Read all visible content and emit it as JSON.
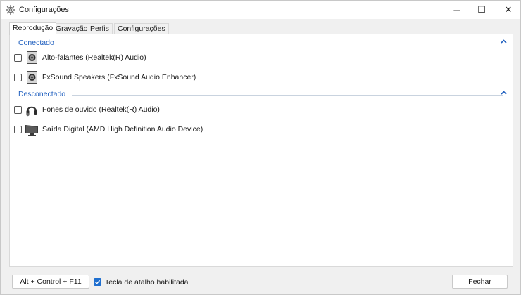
{
  "window": {
    "title": "Configurações",
    "controls": {
      "minimize": "─",
      "maximize": "☐",
      "close": "✕"
    }
  },
  "tabs": [
    {
      "label": "Reprodução",
      "active": true
    },
    {
      "label": "Gravação",
      "active": false
    },
    {
      "label": "Perfis",
      "active": false
    },
    {
      "label": "Configurações",
      "active": false
    }
  ],
  "groups": {
    "connected": {
      "label": "Conectado",
      "devices": [
        {
          "label": "Alto-falantes (Realtek(R) Audio)",
          "icon": "speaker-icon",
          "checked": false
        },
        {
          "label": "FxSound Speakers (FxSound Audio Enhancer)",
          "icon": "speaker-icon",
          "checked": false
        }
      ]
    },
    "disconnected": {
      "label": "Desconectado",
      "devices": [
        {
          "label": "Fones de ouvido (Realtek(R) Audio)",
          "icon": "headphones-icon",
          "checked": false
        },
        {
          "label": "Saída Digital (AMD High Definition Audio Device)",
          "icon": "monitor-icon",
          "checked": false
        }
      ]
    }
  },
  "footer": {
    "hotkey_button": "Alt + Control + F11",
    "hotkey_enabled_label": "Tecla de atalho habilitada",
    "hotkey_enabled": true,
    "close_button": "Fechar"
  },
  "colors": {
    "accent": "#1f6fcf",
    "group_label": "#1f5fbf"
  }
}
